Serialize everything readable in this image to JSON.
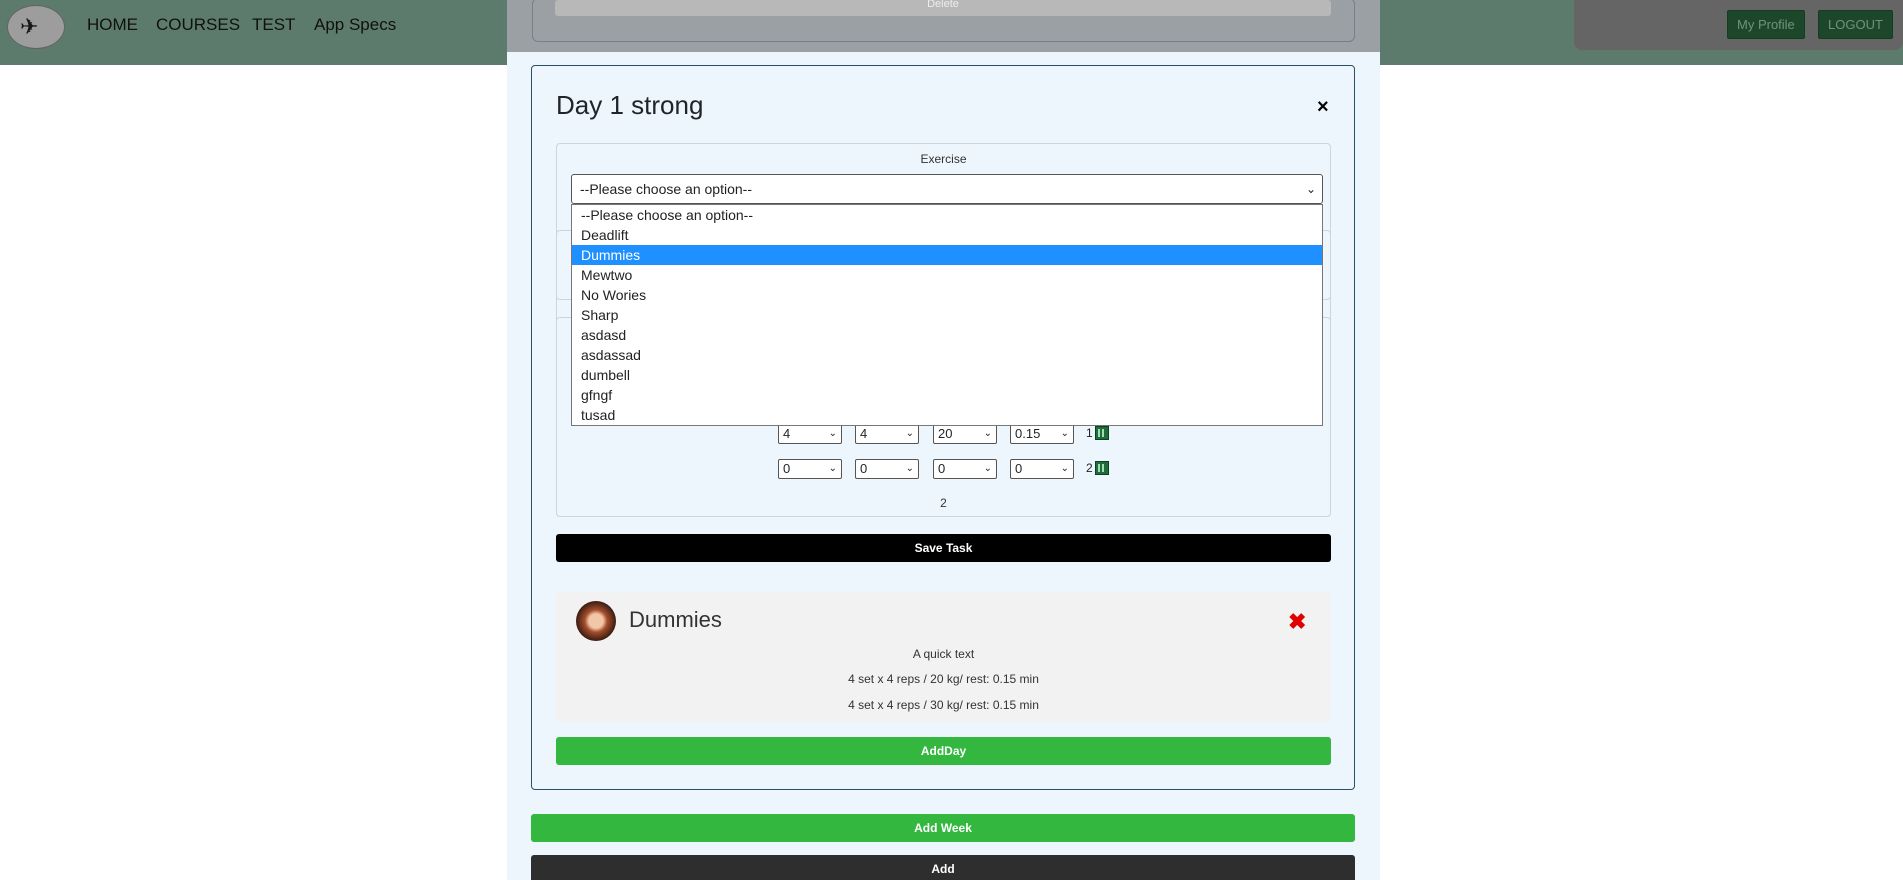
{
  "nav": {
    "links": [
      "HOME",
      "COURSES",
      "TEST",
      "App Specs"
    ],
    "my_profile": "My Profile",
    "logout": "LOGOUT"
  },
  "prev_card": {
    "delete_label": "Delete"
  },
  "day": {
    "title": "Day 1 strong",
    "close": "×",
    "exercise_label": "Exercise",
    "exercise_selected": "--Please choose an option--",
    "exercise_options": [
      "--Please choose an option--",
      "Deadlift",
      "Dummies",
      "Mewtwo",
      "No Wories",
      "Sharp",
      "asdasd",
      "asdassad",
      "dumbell",
      "gfngf",
      "tusad"
    ],
    "highlighted_option": "Dummies",
    "set_rows": [
      {
        "values": [
          "4",
          "4",
          "20",
          "0.15"
        ],
        "num": "1"
      },
      {
        "values": [
          "0",
          "0",
          "0",
          "0"
        ],
        "num": "2"
      }
    ],
    "row_count": "2",
    "save_task": "Save Task",
    "task": {
      "name": "Dummies",
      "delete": "✖",
      "description": "A quick text",
      "lines": [
        "4 set x 4 reps / 20 kg/ rest: 0.15 min",
        "4 set x 4 reps / 30 kg/ rest: 0.15 min"
      ]
    },
    "add_day": "AddDay"
  },
  "add_week": "Add Week",
  "add": "Add",
  "colors": {
    "green": "#33b73f",
    "black": "#000000",
    "danger": "#e00000",
    "highlight": "#1e90ff"
  }
}
